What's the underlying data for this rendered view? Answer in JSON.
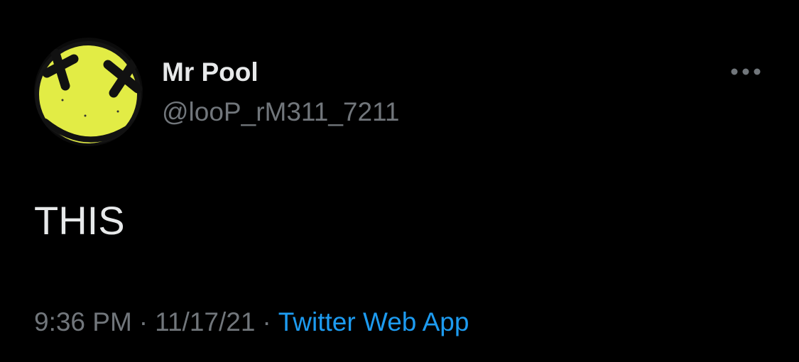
{
  "author": {
    "display_name": "Mr Pool",
    "handle": "@looP_rM311_7211",
    "avatar_icon": "yellow-smiley-x-eyes-icon"
  },
  "tweet": {
    "text": "THIS"
  },
  "meta": {
    "time": "9:36 PM",
    "separator": "·",
    "date": "11/17/21",
    "source": "Twitter Web App"
  },
  "more_icon": "more-dots-icon",
  "colors": {
    "background": "#000000",
    "primary_text": "#e7e9ea",
    "secondary_text": "#71767b",
    "link": "#1d9bf0",
    "avatar_yellow": "#e4f04a"
  }
}
